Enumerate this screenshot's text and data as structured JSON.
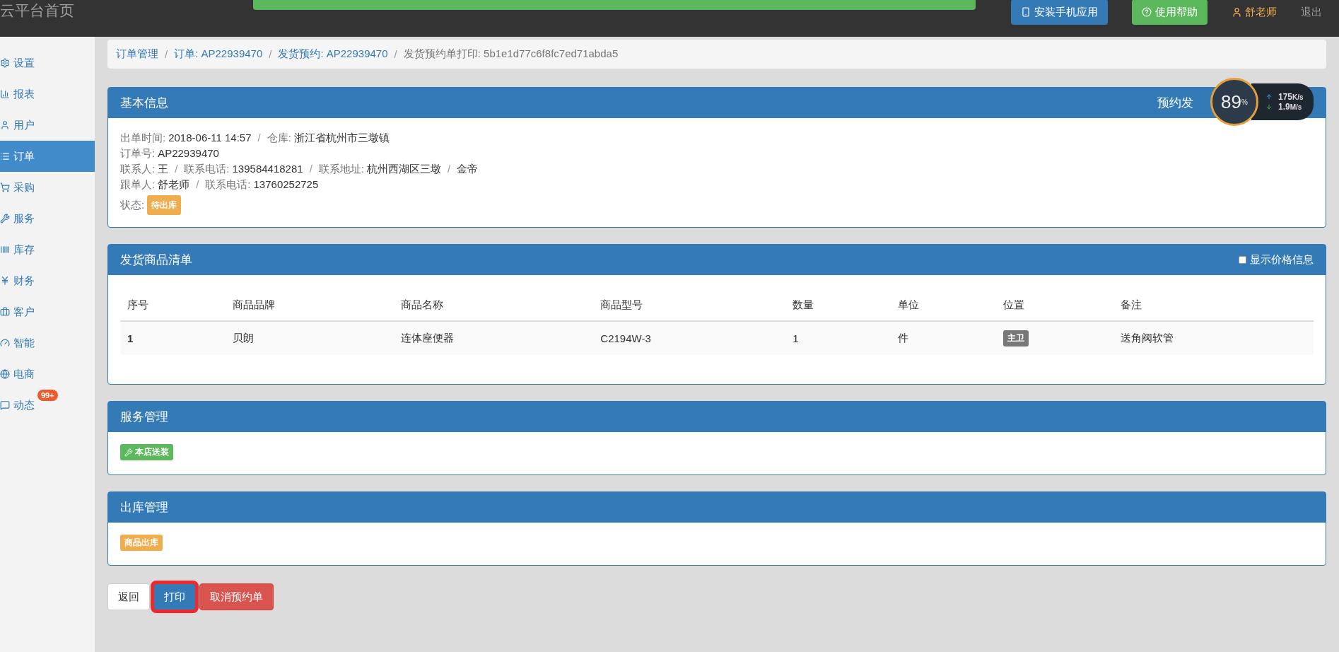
{
  "topbar": {
    "title": "云平台首页",
    "toast": true,
    "buttons": [
      {
        "label": "安装手机应用",
        "kind": "primary"
      },
      {
        "label": "使用帮助",
        "kind": "success"
      }
    ],
    "user": "舒老师",
    "logout": "退出"
  },
  "sidebar": {
    "items": [
      {
        "label": "设置",
        "selected": false
      },
      {
        "label": "报表",
        "selected": false
      },
      {
        "label": "用户",
        "selected": false
      },
      {
        "label": "订单",
        "selected": true
      },
      {
        "label": "采购",
        "selected": false
      },
      {
        "label": "服务",
        "selected": false
      },
      {
        "label": "库存",
        "selected": false
      },
      {
        "label": "财务",
        "selected": false
      },
      {
        "label": "客户",
        "selected": false
      },
      {
        "label": "智能",
        "selected": false
      },
      {
        "label": "电商",
        "selected": false
      },
      {
        "label": "动态",
        "selected": false,
        "badge": "99+"
      }
    ]
  },
  "breadcrumb_separator": "/",
  "info_separator": "/",
  "breadcrumb": [
    {
      "label": "订单管理",
      "link": true
    },
    {
      "label": "订单: AP22939470",
      "link": true
    },
    {
      "label": "发货预约: AP22939470",
      "link": true
    },
    {
      "label": "发货预约单打印: 5b1e1d77c6f8fc7ed71abda5",
      "link": false
    }
  ],
  "basic_info": {
    "title": "基本信息",
    "header_right": "预约发",
    "lines": [
      [
        {
          "label": "出单时间:",
          "value": "2018-06-11 14:57"
        },
        {
          "label": "仓库:",
          "value": "浙江省杭州市三墩镇"
        }
      ],
      [
        {
          "label": "订单号:",
          "value": "AP22939470"
        }
      ],
      [
        {
          "label": "联系人:",
          "value": "王"
        },
        {
          "label": "联系电话:",
          "value": "139584418281"
        },
        {
          "label": "联系地址:",
          "value": "杭州西湖区三墩"
        },
        {
          "value": "金帝"
        }
      ],
      [
        {
          "label": "跟单人:",
          "value": "舒老师"
        },
        {
          "label": "联系电话:",
          "value": "13760252725"
        }
      ]
    ],
    "status_label": "状态:",
    "status": {
      "text": "待出库",
      "kind": "warning"
    }
  },
  "goods": {
    "title": "发货商品清单",
    "show_price": {
      "label": "显示价格信息",
      "checked": false
    },
    "columns": [
      "序号",
      "商品品牌",
      "商品名称",
      "商品型号",
      "数量",
      "单位",
      "位置",
      "备注"
    ],
    "rows": [
      {
        "index": "1",
        "brand": "贝朗",
        "name": "连体座便器",
        "model": "C2194W-3",
        "qty": "1",
        "unit": "件",
        "location": "主卫",
        "note": "送角阀软管"
      }
    ]
  },
  "service": {
    "title": "服务管理",
    "tags": [
      {
        "text": "本店送装",
        "kind": "success"
      }
    ]
  },
  "stock_out": {
    "title": "出库管理",
    "tags": [
      {
        "text": "商品出库",
        "kind": "warning"
      }
    ]
  },
  "actions": [
    {
      "label": "返回",
      "kind": "default",
      "highlighted": false
    },
    {
      "label": "打印",
      "kind": "primary",
      "highlighted": true
    },
    {
      "label": "取消预约单",
      "kind": "danger",
      "highlighted": false
    }
  ],
  "net_monitor": {
    "percent": "89",
    "unit": "%",
    "up": "175",
    "up_unit": "K/s",
    "down": "1.9",
    "down_unit": "M/s"
  }
}
